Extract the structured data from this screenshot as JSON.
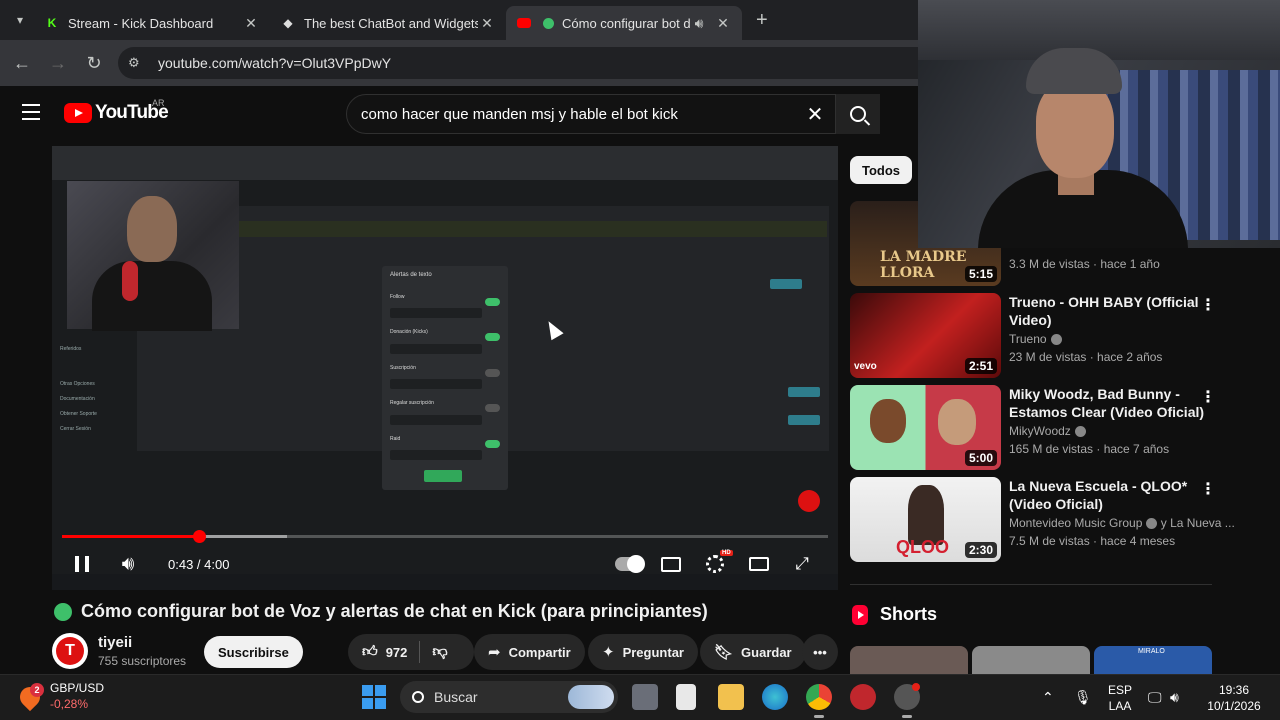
{
  "browser": {
    "tabs": [
      {
        "title": "Stream - Kick Dashboard",
        "favicon": "kick-logo"
      },
      {
        "title": "The best ChatBot and Widgets",
        "favicon": "botrix-logo"
      },
      {
        "title": "Cómo configurar bot de",
        "favicon": "youtube-logo",
        "active": true
      }
    ],
    "url": "youtube.com/watch?v=Olut3VPpDwY"
  },
  "youtube": {
    "logo_text": "YouTube",
    "region": "AR",
    "search_query": "como hacer que manden msj y hable el bot kick"
  },
  "player": {
    "current_time": "0:43",
    "duration": "4:00",
    "time_display": "0:43 / 4:00",
    "progress_fraction": 0.179,
    "buffered_fraction": 0.294,
    "hd_badge": "HD",
    "inner": {
      "modal_title": "Alertas de texto",
      "rows": [
        "Follow",
        "Donación (Kicks)",
        "Suscripción",
        "Regalar suscripción",
        "Raid"
      ],
      "toggles": [
        true,
        true,
        false,
        false,
        true
      ]
    }
  },
  "video": {
    "title": "Cómo configurar bot de Voz y alertas de chat en Kick (para principiantes)",
    "channel": "tiyeii",
    "subscribers": "755 suscriptores",
    "subscribe_label": "Suscribirse",
    "likes": "972",
    "share_label": "Compartir",
    "ask_label": "Preguntar",
    "save_label": "Guardar"
  },
  "sidebar": {
    "chip": "Todos",
    "suggestions": [
      {
        "title": "",
        "channel": "",
        "meta": "3.3 M de vistas · hace 1 año",
        "duration": "5:15",
        "thumb_text": "LA MADRE LLORA"
      },
      {
        "title": "Trueno - OHH BABY (Official Video)",
        "channel": "Trueno",
        "meta": "23 M de vistas · hace 2 años",
        "duration": "2:51",
        "thumb_text": "vevo"
      },
      {
        "title": "Miky Woodz, Bad Bunny - Estamos Clear (Video Oficial)",
        "channel": "MikyWoodz",
        "meta": "165 M de vistas · hace 7 años",
        "duration": "5:00",
        "thumb_text": ""
      },
      {
        "title": "La Nueva Escuela - QLOO* (Video Oficial)",
        "channel": "Montevideo Music Group",
        "channel_extra": "y La Nueva ...",
        "meta": "7.5 M de vistas · hace 4 meses",
        "duration": "2:30",
        "thumb_text": "QLOO"
      }
    ],
    "shorts_label": "Shorts",
    "shorts_thumb_text": "MIRALO"
  },
  "taskbar": {
    "ticker_name": "GBP/USD",
    "ticker_change": "-0,28%",
    "ticker_badge": "2",
    "search_placeholder": "Buscar",
    "lang_top": "ESP",
    "lang_bottom": "LAA",
    "time": "19:36",
    "date": "10/1/2026"
  },
  "colors": {
    "yt_red": "#ff0000",
    "accent_green": "#3ec06a",
    "bg": "#0f0f0f"
  }
}
